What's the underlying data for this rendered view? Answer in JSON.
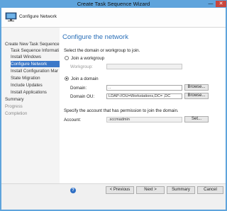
{
  "window": {
    "title": "Create Task Sequence Wizard",
    "minimize_glyph": "—",
    "close_glyph": "✕"
  },
  "header": {
    "title": "Configure Network",
    "icon": "computer-icon"
  },
  "sidebar": {
    "items": [
      {
        "label": "Create New Task Sequence",
        "level": 0,
        "state": "normal"
      },
      {
        "label": "Task Sequence Informati",
        "level": 1,
        "state": "normal"
      },
      {
        "label": "Install Windows",
        "level": 1,
        "state": "normal"
      },
      {
        "label": "Configure Network",
        "level": 1,
        "state": "active"
      },
      {
        "label": "Install Configuration Mar",
        "level": 1,
        "state": "normal"
      },
      {
        "label": "State Migration",
        "level": 1,
        "state": "normal"
      },
      {
        "label": "Include Updates",
        "level": 1,
        "state": "normal"
      },
      {
        "label": "Install Applications",
        "level": 1,
        "state": "normal"
      },
      {
        "label": "Summary",
        "level": 0,
        "state": "normal"
      },
      {
        "label": "Progress",
        "level": 0,
        "state": "muted"
      },
      {
        "label": "Completion",
        "level": 0,
        "state": "muted"
      }
    ]
  },
  "main": {
    "title": "Configure the network",
    "instruction": "Select the domain or workgroup to join.",
    "workgroup_option": "Join a workgroup",
    "workgroup_label": "Workgroup:",
    "workgroup_value": "",
    "domain_option": "Join a domain",
    "domain_label": "Domain:",
    "domain_value": "..",
    "domain_ou_label": "Domain OU:",
    "domain_ou_value": "LDAP://OU=Workstations,DC=                    ,DC",
    "browse_label": "Browse...",
    "account_instruction": "Specify the account that has permission to join the domain.",
    "account_label": "Account:",
    "account_value": "                    .sccmadmin",
    "set_label": "Set...",
    "selected": "domain"
  },
  "footer": {
    "help_glyph": "?",
    "previous_label": "< Previous",
    "next_label": "Next >",
    "summary_label": "Summary",
    "cancel_label": "Cancel"
  }
}
